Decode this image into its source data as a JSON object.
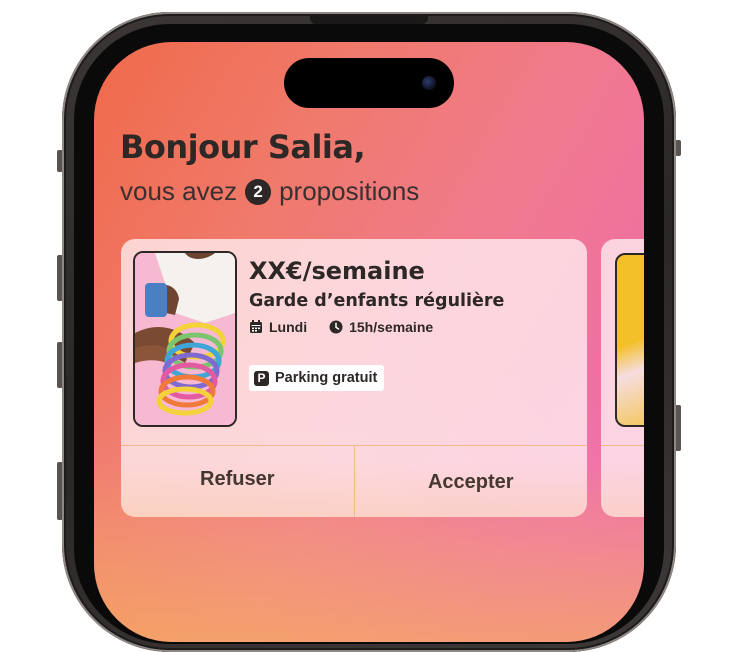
{
  "header": {
    "greeting": "Bonjour Salia,",
    "subtitle_before": "vous avez",
    "proposal_count": "2",
    "subtitle_after": "propositions"
  },
  "offer_card": {
    "price": "XX€/semaine",
    "job_type": "Garde d’enfants régulière",
    "day": "Lundi",
    "hours": "15h/semaine",
    "perk_icon": "P",
    "perk": "Parking gratuit",
    "refuse_label": "Refuser",
    "accept_label": "Accepter"
  },
  "icons": {
    "calendar": "calendar-icon",
    "clock": "clock-icon",
    "parking": "parking-icon"
  },
  "colors": {
    "text_dark": "#2d2726",
    "gradient_orange": "#ef6a4a",
    "gradient_pink": "#ee6aa8",
    "gradient_yellow": "#f6b246",
    "divider": "#f4b98a"
  }
}
